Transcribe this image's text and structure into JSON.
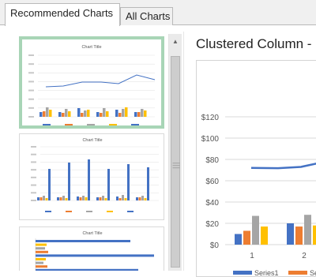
{
  "tabs": {
    "recommended": "Recommended Charts",
    "all": "All Charts"
  },
  "thumbnails": [
    {
      "title": "Chart Title",
      "kind": "clustered-column-line"
    },
    {
      "title": "Chart Title",
      "kind": "clustered-column-tall"
    },
    {
      "title": "Chart Title",
      "kind": "clustered-bar"
    }
  ],
  "preview": {
    "title": "Clustered Column -",
    "y_ticks": [
      "$120",
      "$100",
      "$80",
      "$60",
      "$40",
      "$20",
      "$0"
    ],
    "x_ticks": [
      "1",
      "2"
    ],
    "legend": [
      "Series1",
      "Se"
    ]
  },
  "colors": {
    "series1": "#4472c4",
    "series2": "#ed7d31",
    "series3": "#a5a5a5",
    "series4": "#ffc000",
    "selected_border": "#a8d5b6"
  },
  "chart_data": {
    "type": "bar",
    "categories": [
      "1",
      "2"
    ],
    "series": [
      {
        "name": "Series1",
        "values": [
          10,
          20
        ]
      },
      {
        "values": [
          13,
          17
        ]
      },
      {
        "values": [
          27,
          28
        ]
      },
      {
        "values": [
          17,
          18
        ]
      },
      {
        "values": [
          72,
          73
        ]
      }
    ],
    "ylim": [
      0,
      120
    ]
  }
}
